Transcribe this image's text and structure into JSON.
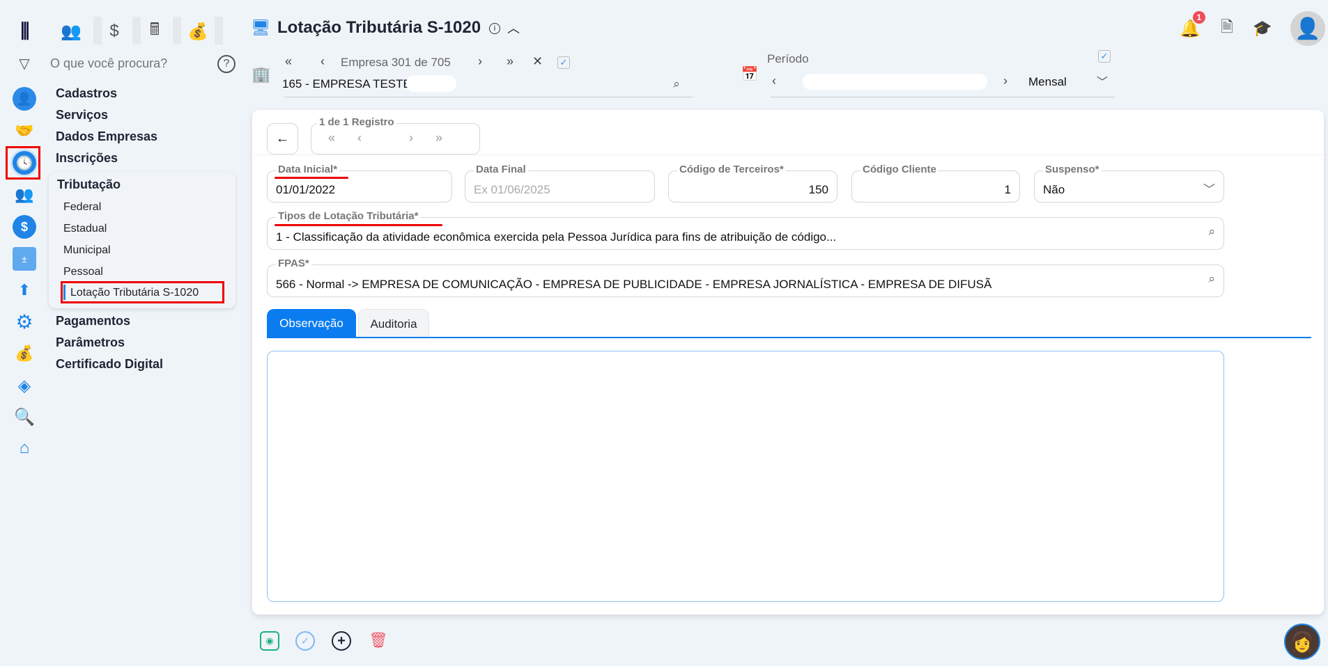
{
  "header": {
    "title": "Lotação Tributária S-1020",
    "notifications": "1"
  },
  "sidebar": {
    "search_placeholder": "O que você procura?",
    "menu": [
      "Cadastros",
      "Serviços",
      "Dados Empresas",
      "Inscrições"
    ],
    "submenu_title": "Tributação",
    "submenu": [
      "Federal",
      "Estadual",
      "Municipal",
      "Pessoal",
      "Lotação Tributária S-1020"
    ],
    "menu_after": [
      "Pagamentos",
      "Parâmetros",
      "Certificado Digital"
    ]
  },
  "empresa": {
    "nav_label": "Empresa 301 de 705",
    "name": "165 - EMPRESA TESTE"
  },
  "periodo": {
    "label": "Período",
    "type": "Mensal"
  },
  "record": {
    "label": "1 de 1 Registro"
  },
  "form": {
    "data_inicial": {
      "label": "Data Inicial*",
      "value": "01/01/2022"
    },
    "data_final": {
      "label": "Data Final",
      "placeholder": "Ex 01/06/2025"
    },
    "codigo_terceiros": {
      "label": "Código de Terceiros*",
      "value": "150"
    },
    "codigo_cliente": {
      "label": "Código Cliente",
      "value": "1"
    },
    "suspenso": {
      "label": "Suspenso*",
      "value": "Não"
    },
    "tipos": {
      "label": "Tipos de Lotação Tributária*",
      "value": "1 - Classificação da atividade econômica exercida pela Pessoa Jurídica para fins de atribuição de código..."
    },
    "fpas": {
      "label": "FPAS*",
      "value": "566 - Normal -> EMPRESA DE COMUNICAÇÃO - EMPRESA DE PUBLICIDADE - EMPRESA JORNALÍSTICA - EMPRESA DE DIFUSÃ"
    }
  },
  "tabs": [
    "Observação",
    "Auditoria"
  ],
  "colors": {
    "accent": "#0a7cf0",
    "save": "#1bb27a",
    "delete": "#f05a68"
  }
}
